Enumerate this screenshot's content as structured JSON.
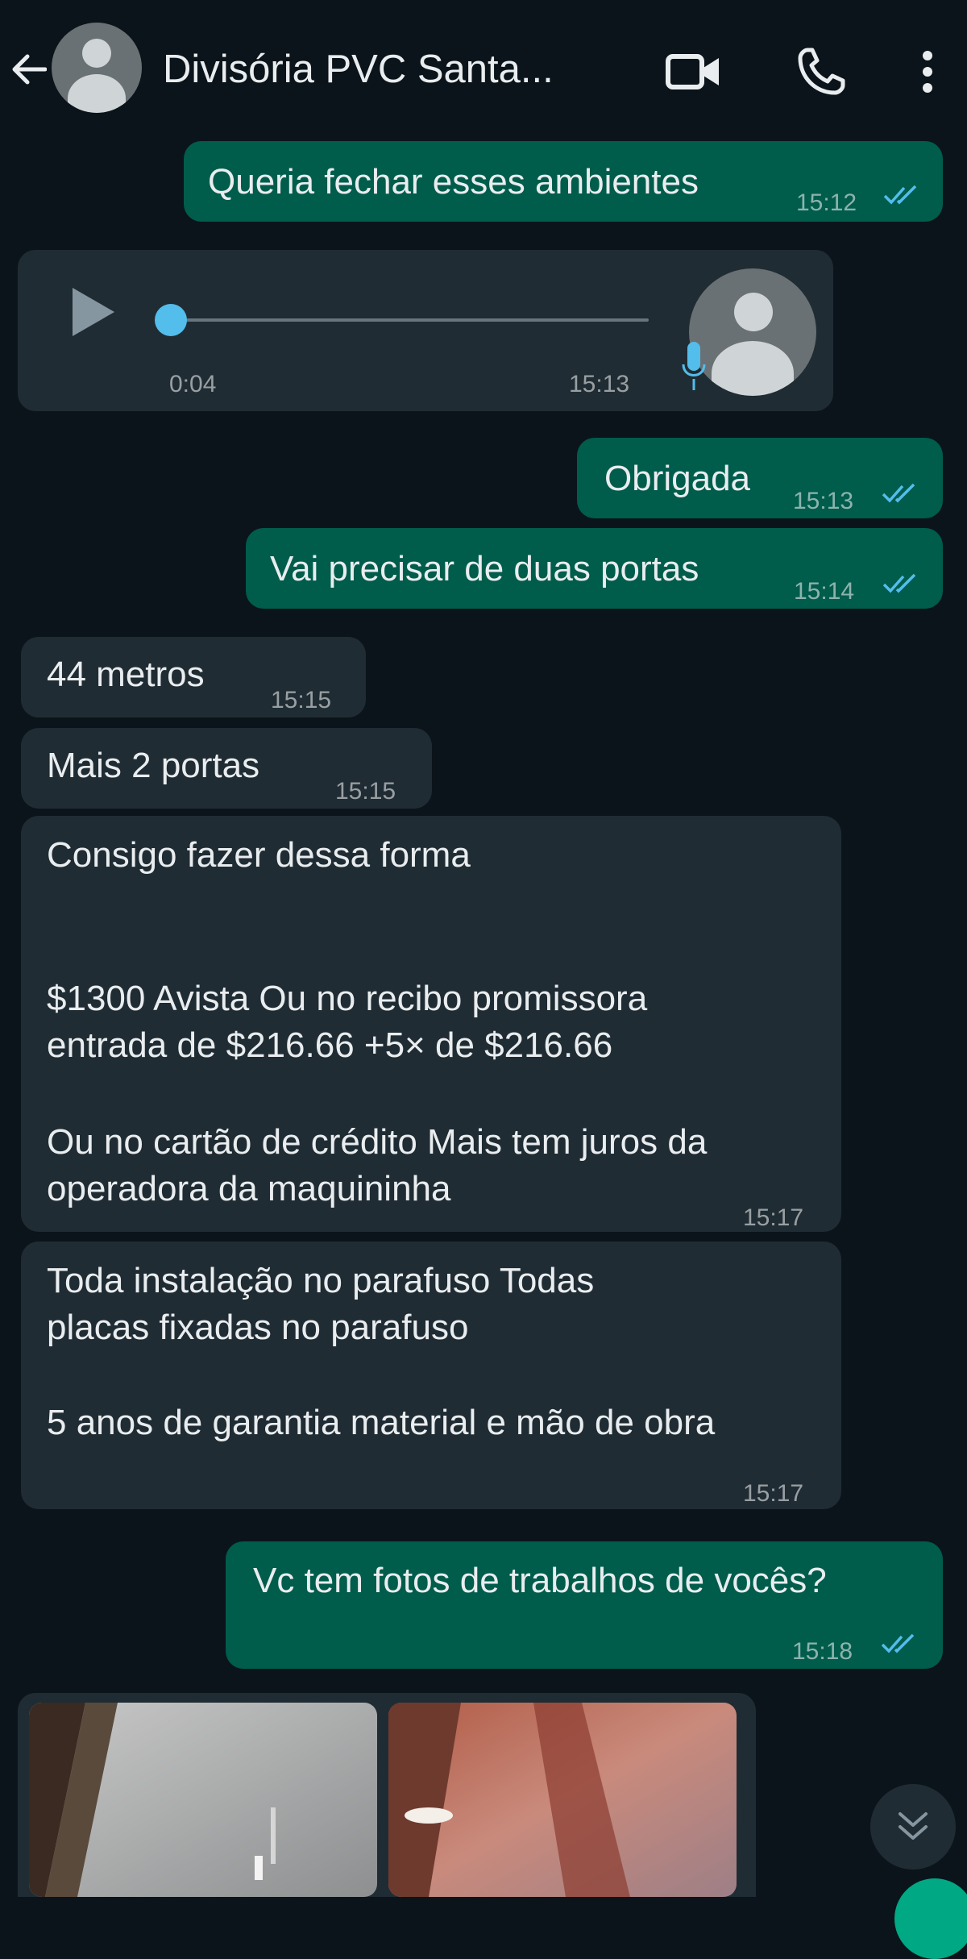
{
  "header": {
    "contact_name": "Divisória PVC Santa...",
    "back_icon": "arrow-left-icon",
    "video_icon": "video-call-icon",
    "call_icon": "phone-icon",
    "menu_icon": "more-vert-icon"
  },
  "messages": [
    {
      "dir": "out",
      "text": "Queria fechar esses ambientes",
      "time": "15:12"
    },
    {
      "dir": "in",
      "type": "voice",
      "duration": "0:04",
      "time": "15:13"
    },
    {
      "dir": "out",
      "text": "Obrigada",
      "time": "15:13"
    },
    {
      "dir": "out",
      "text": "Vai precisar de duas portas",
      "time": "15:14"
    },
    {
      "dir": "in",
      "text": "44 metros",
      "time": "15:15"
    },
    {
      "dir": "in",
      "text": "Mais 2 portas",
      "time": "15:15"
    },
    {
      "dir": "in",
      "lines": [
        "Consigo fazer dessa forma",
        "",
        "",
        "$1300 Avista Ou no recibo  promissora",
        "entrada de $216.66 +5× de $216.66",
        "",
        "Ou no cartão de crédito Mais tem juros da",
        "operadora da maquininha"
      ],
      "time": "15:17"
    },
    {
      "dir": "in",
      "lines": [
        "Toda instalação no parafuso Todas",
        "placas fixadas no parafuso",
        "",
        "5 anos de garantia material e mão de obra"
      ],
      "time": "15:17"
    },
    {
      "dir": "out",
      "text": "Vc tem fotos de trabalhos de vocês?",
      "time": "15:18"
    }
  ],
  "colors": {
    "background": "#0b141a",
    "outgoing": "#005c4b",
    "incoming": "#202c33",
    "read_ticks": "#53bdeb"
  }
}
